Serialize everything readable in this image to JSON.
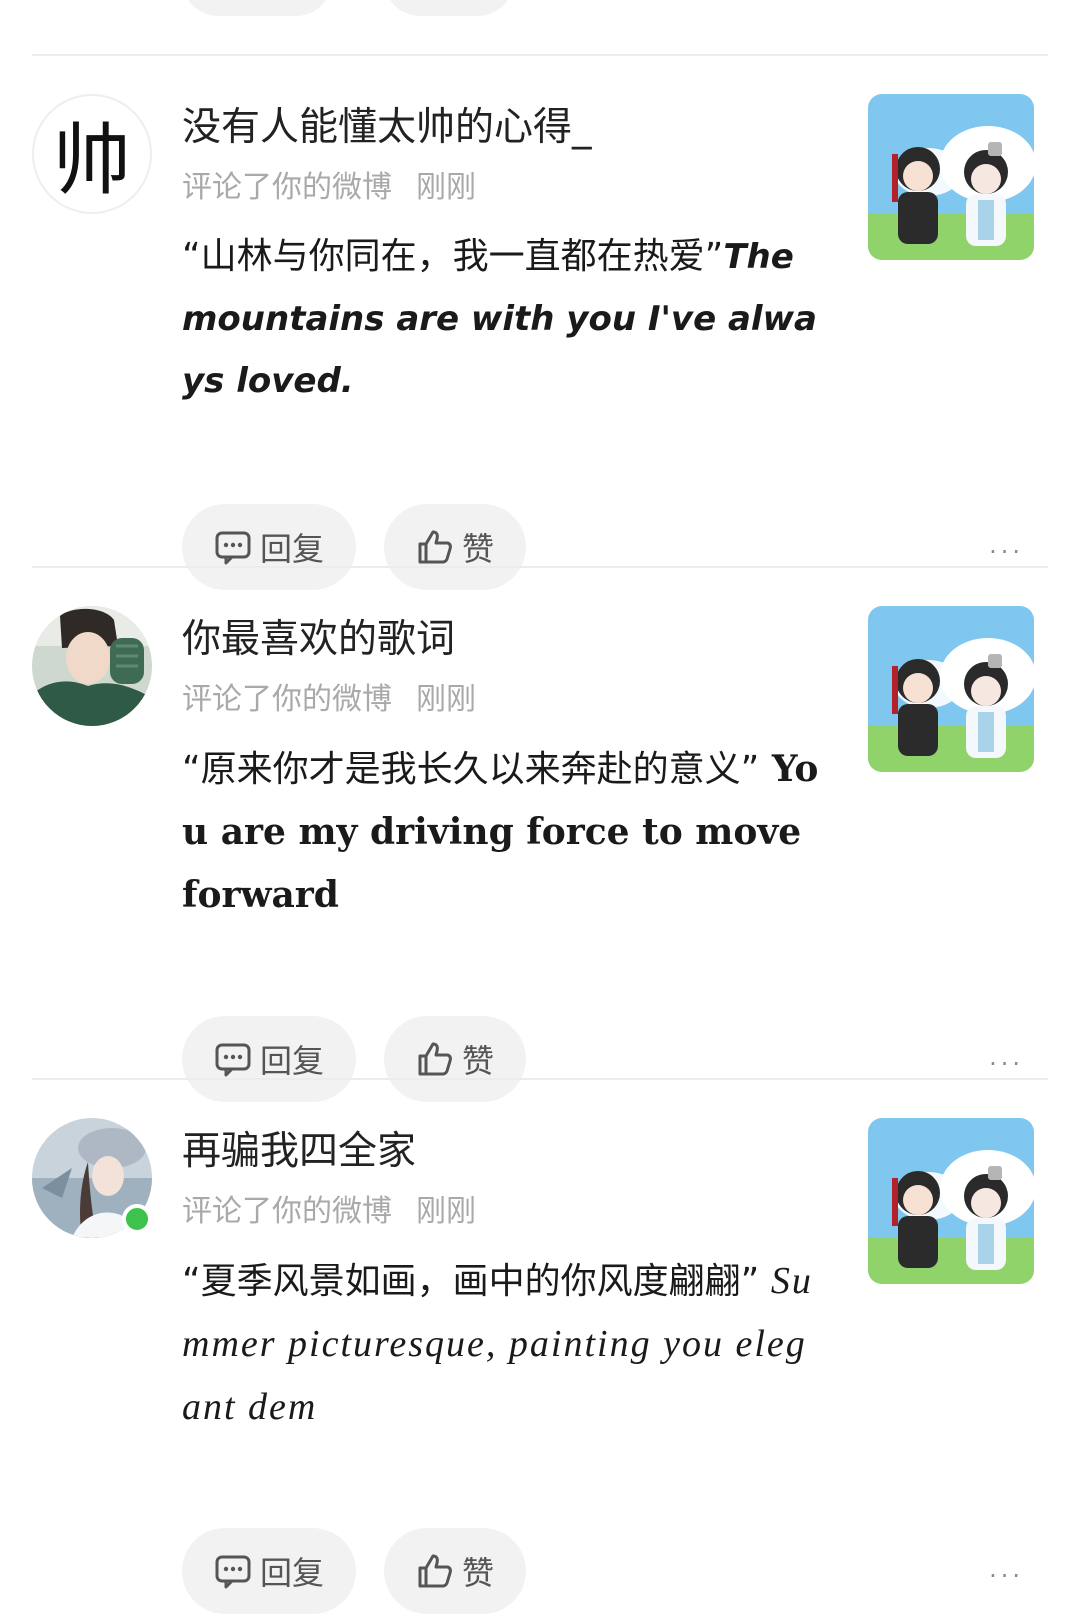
{
  "actions": {
    "reply_label": "回复",
    "like_label": "赞",
    "more_label": "···"
  },
  "notifications": [
    {
      "avatar_text": "帅",
      "username": "没有人能懂太帅的心得_",
      "action_text": "评论了你的微博",
      "time": "刚刚",
      "comment_cn": "“山林与你同在，我一直都在热爱”",
      "comment_en": "The mountains are with you I've always loved."
    },
    {
      "username": "你最喜欢的歌词",
      "action_text": "评论了你的微博",
      "time": "刚刚",
      "comment_cn": "“原来你才是我长久以来奔赴的意义”",
      "comment_en": " You are my driving force to move forward"
    },
    {
      "username": "再骗我四全家",
      "action_text": "评论了你的微博",
      "time": "刚刚",
      "comment_cn": "“夏季风景如画，画中的你风度翩翩”",
      "comment_en": " Summer picturesque, painting you elegant dem",
      "online": true
    }
  ],
  "colors": {
    "pill_bg": "#f2f2f2",
    "meta_gray": "#a9a9a9",
    "divider": "#ececec",
    "online_green": "#3dc24b"
  }
}
